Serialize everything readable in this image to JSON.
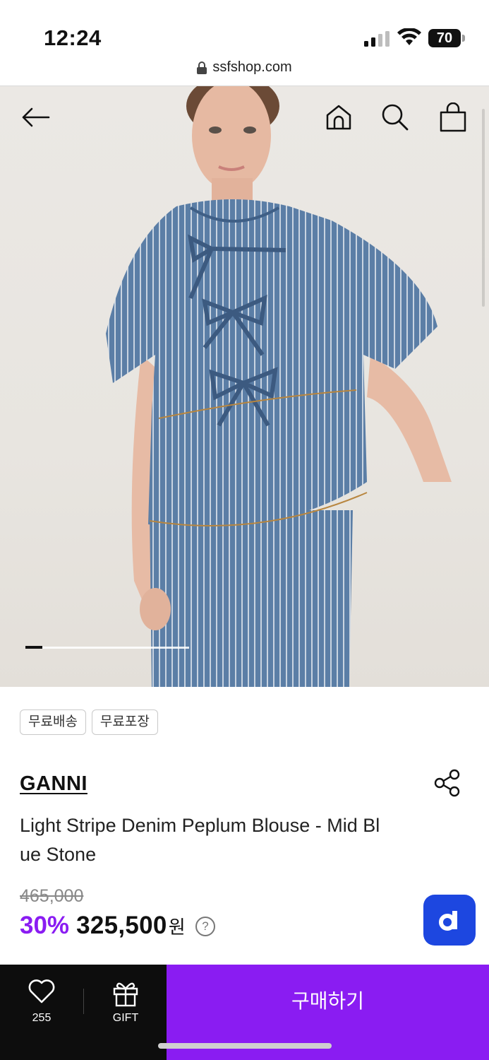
{
  "status_bar": {
    "time": "12:24",
    "battery": "70",
    "icons": [
      "signal-icon",
      "wifi-icon",
      "battery-icon"
    ]
  },
  "browser": {
    "url": "ssfshop.com",
    "lock_icon": "lock-icon"
  },
  "header": {
    "back_icon": "arrow-left-icon",
    "home_icon": "home-icon",
    "search_icon": "search-icon",
    "cart_icon": "shopping-bag-icon"
  },
  "gallery": {
    "image_alt": "Light Stripe Denim Peplum Blouse - Mid Blue Stone"
  },
  "badges": [
    "무료배송",
    "무료포장"
  ],
  "product": {
    "brand": "GANNI",
    "name": "Light Stripe Denim Peplum Blouse - Mid Blue Stone",
    "original_price": "465,000",
    "discount": "30%",
    "price": "325,500",
    "currency": "원",
    "help": "?"
  },
  "bottom_bar": {
    "like_count": "255",
    "gift_label": "GIFT",
    "buy_label": "구매하기"
  },
  "colors": {
    "accent": "#8a1cf2",
    "d_button": "#1d47e0",
    "bottom_bar": "#0d0d0d"
  }
}
